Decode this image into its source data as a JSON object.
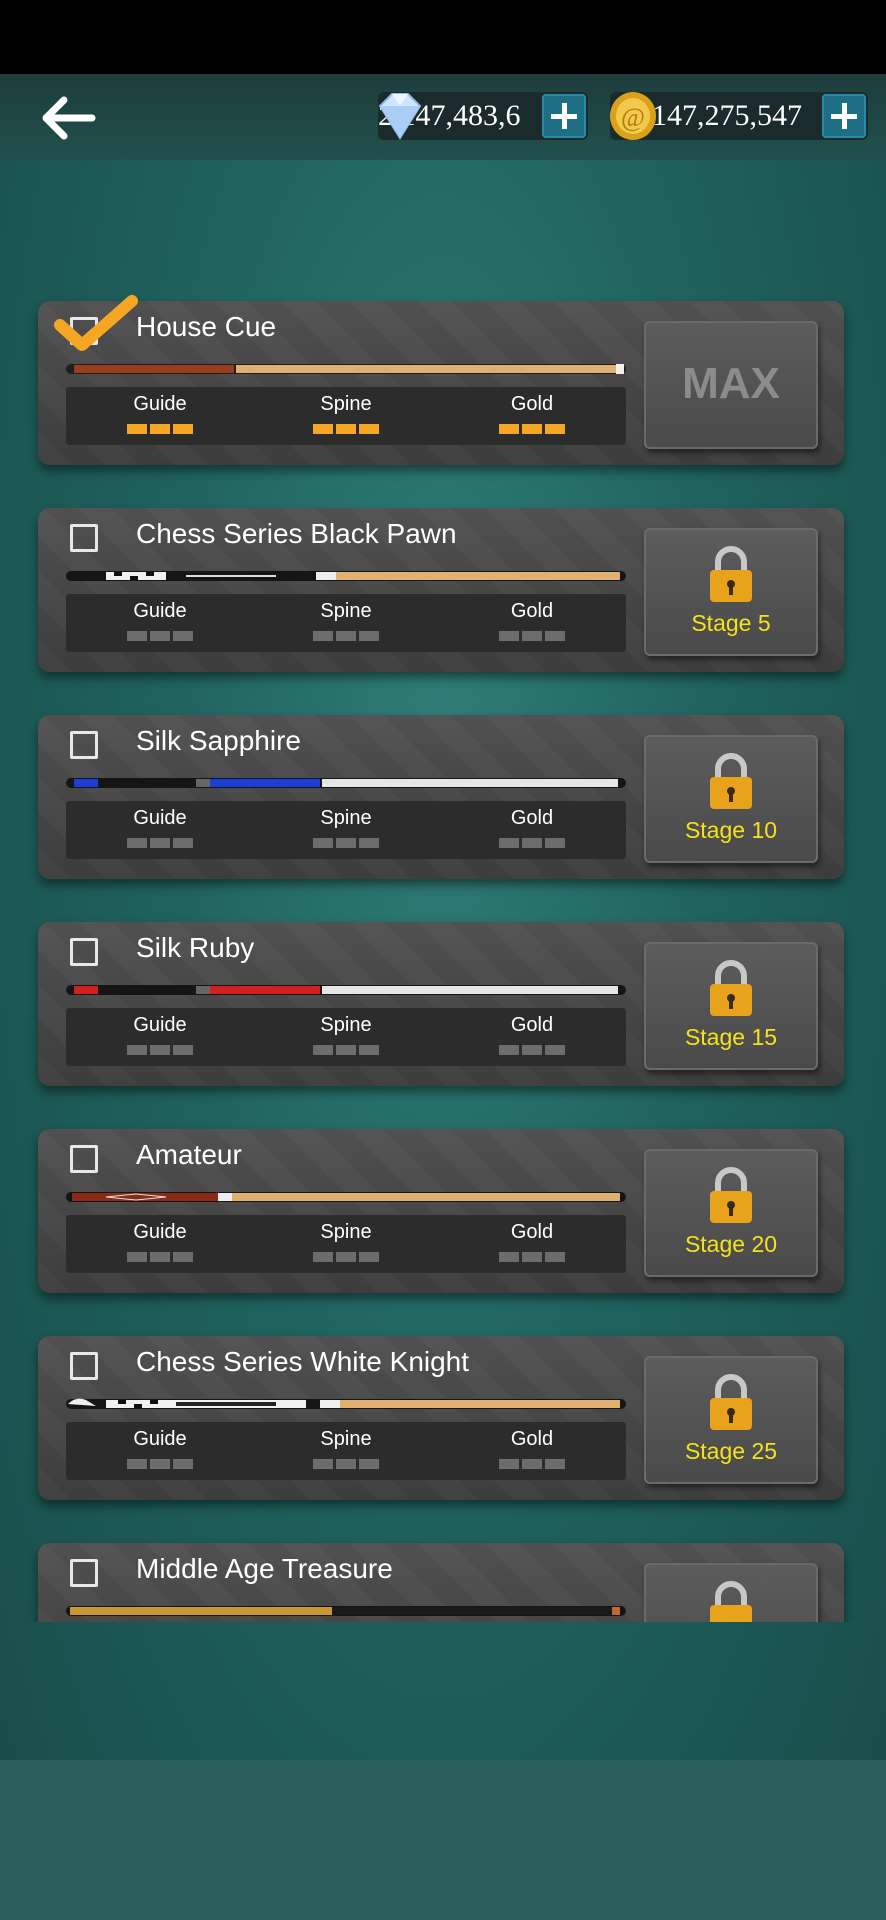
{
  "currency": {
    "gems": "2,147,483,6",
    "gold": "147,275,547"
  },
  "cues": [
    {
      "name": "House Cue",
      "selected": true,
      "status": "MAX",
      "stage": "",
      "guide": 3,
      "spine": 3,
      "gold": 3
    },
    {
      "name": "Chess Series Black Pawn",
      "selected": false,
      "status": "locked",
      "stage": "Stage 5",
      "guide": 0,
      "spine": 0,
      "gold": 0
    },
    {
      "name": "Silk Sapphire",
      "selected": false,
      "status": "locked",
      "stage": "Stage 10",
      "guide": 0,
      "spine": 0,
      "gold": 0
    },
    {
      "name": "Silk Ruby",
      "selected": false,
      "status": "locked",
      "stage": "Stage 15",
      "guide": 0,
      "spine": 0,
      "gold": 0
    },
    {
      "name": "Amateur",
      "selected": false,
      "status": "locked",
      "stage": "Stage 20",
      "guide": 0,
      "spine": 0,
      "gold": 0
    },
    {
      "name": "Chess Series White Knight",
      "selected": false,
      "status": "locked",
      "stage": "Stage 25",
      "guide": 0,
      "spine": 0,
      "gold": 0
    },
    {
      "name": "Middle Age Treasure",
      "selected": false,
      "status": "locked",
      "stage": "",
      "guide": 0,
      "spine": 0,
      "gold": 0
    }
  ],
  "stat_labels": {
    "guide": "Guide",
    "spine": "Spine",
    "gold": "Gold"
  },
  "colors": {
    "accent_orange": "#f5a623",
    "stage_yellow": "#f4e21a",
    "plus_blue": "#1e6e86"
  }
}
